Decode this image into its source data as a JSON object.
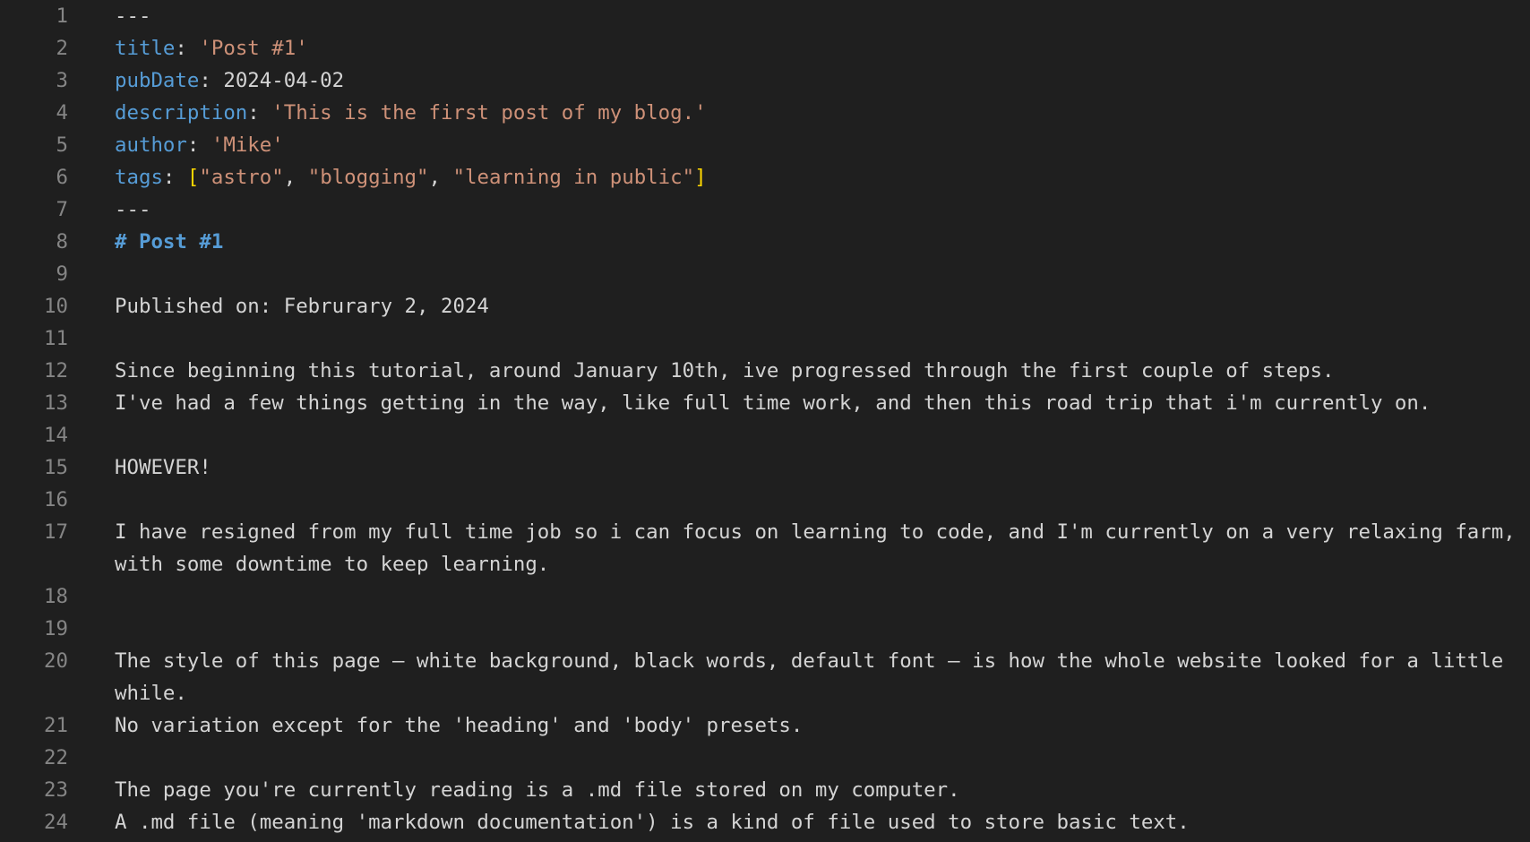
{
  "editor": {
    "theme": {
      "background": "#1f1f1f",
      "gutter_color": "#858585",
      "key_color": "#569cd6",
      "string_color": "#ce9178",
      "bracket_color": "#ffd700",
      "text_color": "#d4d4d4"
    },
    "lines": [
      {
        "num": "1",
        "frontmatter_delim": "---"
      },
      {
        "num": "2",
        "key": "title",
        "sep": ": ",
        "value": "'Post #1'"
      },
      {
        "num": "3",
        "key": "pubDate",
        "sep": ": ",
        "value": "2024-04-02"
      },
      {
        "num": "4",
        "key": "description",
        "sep": ": ",
        "value": "'This is the first post of my blog.'"
      },
      {
        "num": "5",
        "key": "author",
        "sep": ": ",
        "value": "'Mike'"
      },
      {
        "num": "6",
        "key": "tags",
        "sep": ": ",
        "open": "[",
        "t1": "\"astro\"",
        "c1": ", ",
        "t2": "\"blogging\"",
        "c2": ", ",
        "t3": "\"learning in public\"",
        "close": "]"
      },
      {
        "num": "7",
        "frontmatter_delim": "---"
      },
      {
        "num": "8",
        "heading": "# Post #1"
      },
      {
        "num": "9",
        "text": ""
      },
      {
        "num": "10",
        "text": "Published on: Februrary 2, 2024"
      },
      {
        "num": "11",
        "text": ""
      },
      {
        "num": "12",
        "text": "Since beginning this tutorial, around January 10th, ive progressed through the first couple of steps."
      },
      {
        "num": "13",
        "text": "I've had a few things getting in the way, like full time work, and then this road trip that i'm currently on."
      },
      {
        "num": "14",
        "text": ""
      },
      {
        "num": "15",
        "text": "HOWEVER!"
      },
      {
        "num": "16",
        "text": ""
      },
      {
        "num": "17",
        "text": "I have resigned from my full time job so i can focus on learning to code, and I'm currently on a very relaxing farm, with some downtime to keep learning."
      },
      {
        "num": "18",
        "text": ""
      },
      {
        "num": "19",
        "text": ""
      },
      {
        "num": "20",
        "text": "The style of this page – white background, black words, default font – is how the whole website looked for a little while."
      },
      {
        "num": "21",
        "text": "No variation except for the 'heading' and 'body' presets."
      },
      {
        "num": "22",
        "text": ""
      },
      {
        "num": "23",
        "text": "The page you're currently reading is a .md file stored on my computer."
      },
      {
        "num": "24",
        "text": "A .md file (meaning 'markdown documentation') is a kind of file used to store basic text."
      }
    ]
  }
}
